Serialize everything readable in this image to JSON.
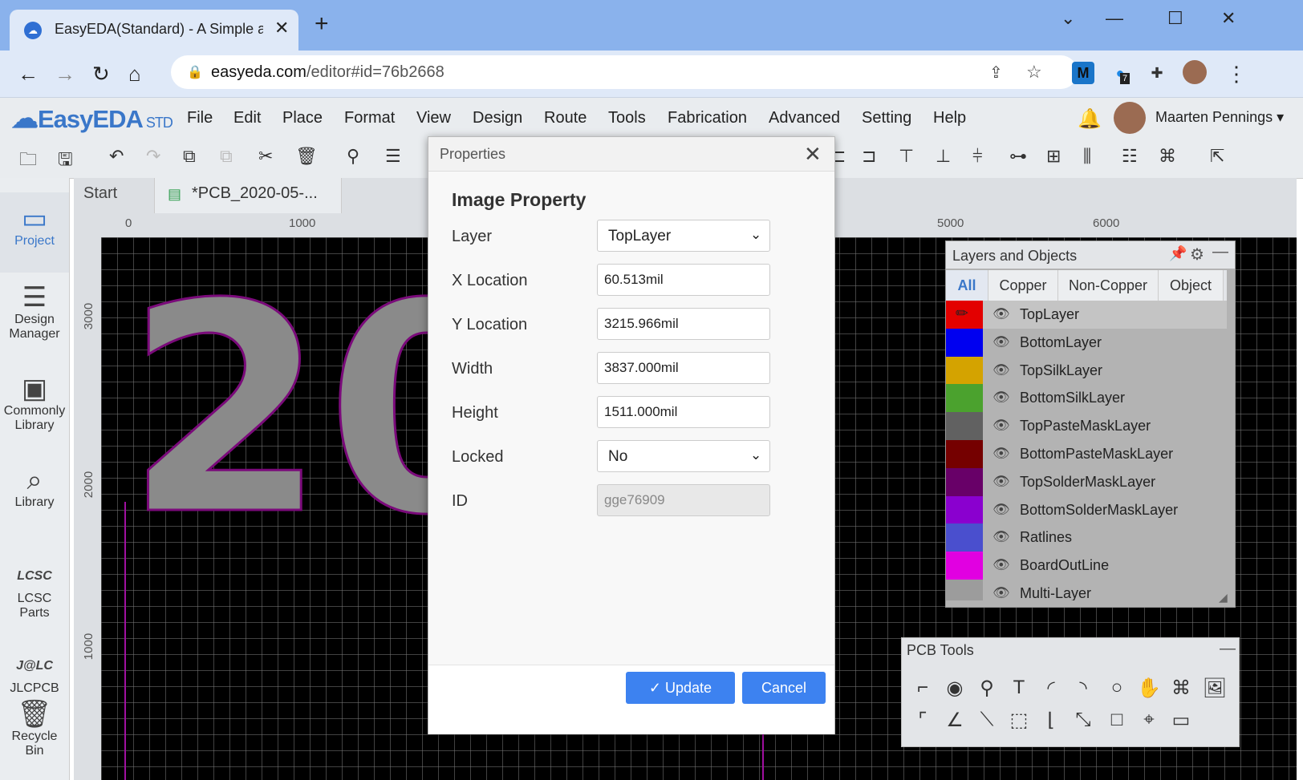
{
  "browser": {
    "tab_title": "EasyEDA(Standard) - A Simple an",
    "url_host": "easyeda.com",
    "url_path": "/editor#id=76b2668",
    "extension_badge": "7"
  },
  "app": {
    "logo_text": "EasyEDA",
    "logo_suffix": "STD",
    "menu": [
      "File",
      "Edit",
      "Place",
      "Format",
      "View",
      "Design",
      "Route",
      "Tools",
      "Fabrication",
      "Advanced",
      "Setting",
      "Help"
    ],
    "user_name": "Maarten Pennings ▾"
  },
  "sidebar": {
    "items": [
      {
        "label": "Project",
        "icon": "folder-icon"
      },
      {
        "label": "Design Manager",
        "icon": "list-icon"
      },
      {
        "label": "Commonly Library",
        "icon": "chip-icon"
      },
      {
        "label": "Library",
        "icon": "search-chip-icon"
      },
      {
        "label": "LCSC Parts",
        "icon": "lcsc-icon"
      },
      {
        "label": "JLCPCB",
        "icon": "jlc-icon"
      },
      {
        "label": "Recycle Bin",
        "icon": "trash-icon"
      }
    ]
  },
  "doc_tabs": {
    "start": "Start",
    "pcb": "*PCB_2020-05-..."
  },
  "ruler": {
    "top": [
      "0",
      "1000",
      "5000",
      "6000"
    ],
    "left": [
      "3000",
      "2000",
      "1000"
    ]
  },
  "dialog": {
    "title": "Properties",
    "heading": "Image Property",
    "fields": {
      "layer": {
        "label": "Layer",
        "value": "TopLayer"
      },
      "x": {
        "label": "X Location",
        "value": "60.513mil"
      },
      "y": {
        "label": "Y Location",
        "value": "3215.966mil"
      },
      "width": {
        "label": "Width",
        "value": "3837.000mil"
      },
      "height": {
        "label": "Height",
        "value": "1511.000mil"
      },
      "locked": {
        "label": "Locked",
        "value": "No"
      },
      "id": {
        "label": "ID",
        "value": "gge76909"
      }
    },
    "update_label": "Update",
    "cancel_label": "Cancel"
  },
  "layers_panel": {
    "title": "Layers and Objects",
    "tabs": [
      "All",
      "Copper",
      "Non-Copper",
      "Object"
    ],
    "layers": [
      {
        "name": "TopLayer",
        "color": "#e30000"
      },
      {
        "name": "BottomLayer",
        "color": "#0000f0"
      },
      {
        "name": "TopSilkLayer",
        "color": "#d4a300"
      },
      {
        "name": "BottomSilkLayer",
        "color": "#4ba22e"
      },
      {
        "name": "TopPasteMaskLayer",
        "color": "#616161"
      },
      {
        "name": "BottomPasteMaskLayer",
        "color": "#750000"
      },
      {
        "name": "TopSolderMaskLayer",
        "color": "#680068"
      },
      {
        "name": "BottomSolderMaskLayer",
        "color": "#8a00cf"
      },
      {
        "name": "Ratlines",
        "color": "#4a4fce"
      },
      {
        "name": "BoardOutLine",
        "color": "#e100e1"
      },
      {
        "name": "Multi-Layer",
        "color": "#9c9c9c"
      }
    ]
  },
  "pcb_tools": {
    "title": "PCB Tools"
  },
  "canvas_text": "20"
}
